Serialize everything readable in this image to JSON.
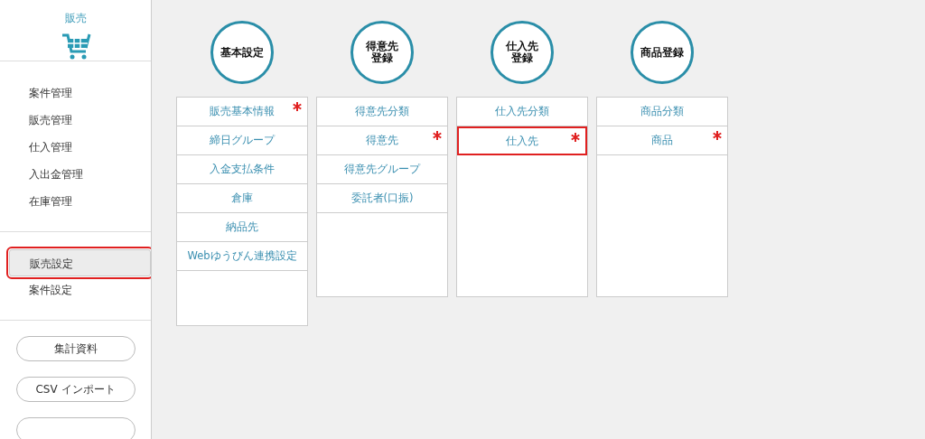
{
  "sidebar": {
    "title": "販売",
    "menu": [
      {
        "label": "案件管理"
      },
      {
        "label": "販売管理"
      },
      {
        "label": "仕入管理"
      },
      {
        "label": "入出金管理"
      },
      {
        "label": "在庫管理"
      }
    ],
    "settings": [
      {
        "label": "販売設定",
        "selected": true,
        "highlighted": true
      },
      {
        "label": "案件設定",
        "selected": false,
        "highlighted": false
      }
    ],
    "buttons": [
      {
        "label": "集計資料"
      },
      {
        "label": "CSV インポート"
      }
    ]
  },
  "groups": [
    {
      "title_lines": [
        "基本設定"
      ],
      "items": [
        {
          "label": "販売基本情報",
          "required": true,
          "highlighted": false
        },
        {
          "label": "締日グループ",
          "required": false,
          "highlighted": false
        },
        {
          "label": "入金支払条件",
          "required": false,
          "highlighted": false
        },
        {
          "label": "倉庫",
          "required": false,
          "highlighted": false
        },
        {
          "label": "納品先",
          "required": false,
          "highlighted": false
        },
        {
          "label": "Webゆうびん連携設定",
          "required": false,
          "highlighted": false
        }
      ]
    },
    {
      "title_lines": [
        "得意先",
        "登録"
      ],
      "items": [
        {
          "label": "得意先分類",
          "required": false,
          "highlighted": false
        },
        {
          "label": "得意先",
          "required": true,
          "highlighted": false
        },
        {
          "label": "得意先グループ",
          "required": false,
          "highlighted": false
        },
        {
          "label": "委託者(口振)",
          "required": false,
          "highlighted": false
        }
      ]
    },
    {
      "title_lines": [
        "仕入先",
        "登録"
      ],
      "items": [
        {
          "label": "仕入先分類",
          "required": false,
          "highlighted": false
        },
        {
          "label": "仕入先",
          "required": true,
          "highlighted": true
        }
      ]
    },
    {
      "title_lines": [
        "商品登録"
      ],
      "items": [
        {
          "label": "商品分類",
          "required": false,
          "highlighted": false
        },
        {
          "label": "商品",
          "required": true,
          "highlighted": false
        }
      ]
    }
  ]
}
